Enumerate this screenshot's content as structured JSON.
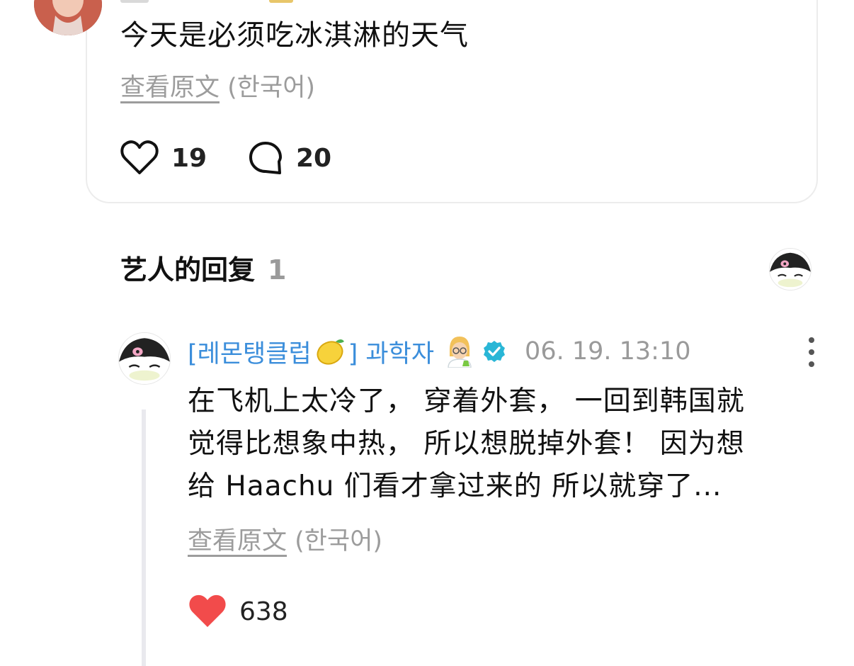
{
  "post": {
    "text": "今天是必须吃冰淇淋的天气",
    "view_original": "查看原文",
    "original_lang": "(한국어)",
    "likes": "19",
    "comments": "20"
  },
  "artist_replies": {
    "title": "艺人的回复",
    "count": "1"
  },
  "reply": {
    "author_prefix": "[레몬탱클럽",
    "author_suffix": "] 과학자",
    "date": "06. 19. 13:10",
    "lines": [
      "在飞机上太冷了， 穿着外套， 一回到韩国就",
      "觉得比想象中热， 所以想脱掉外套！ 因为想",
      "给 Haachu 们看才拿过来的 所以就穿了..."
    ],
    "view_original": "查看原文",
    "original_lang": "(한국어)",
    "likes": "638"
  },
  "colors": {
    "author_blue": "#3b8edb",
    "like_red": "#f24b4b",
    "verified": "#29b6d6",
    "muted": "#9a9a9a"
  },
  "icons": {
    "like": "heart-outline-icon",
    "comment": "speech-bubble-icon",
    "liked": "heart-filled-icon",
    "verified": "verified-badge-icon",
    "more": "more-vertical-icon"
  }
}
